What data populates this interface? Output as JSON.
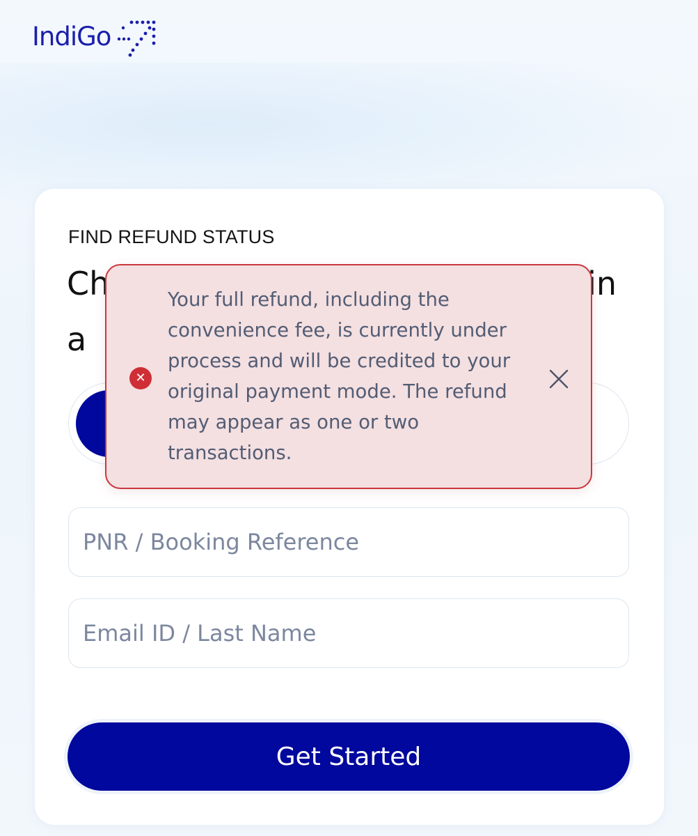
{
  "header": {
    "logo_text": "IndiGo",
    "logo_icon": "indigo-plane-dots-logo",
    "brand_color": "#1b1eaa"
  },
  "card": {
    "eyebrow": "FIND REFUND STATUS",
    "heading_visible_start_line1": "Ch",
    "heading_visible_end_line1": "in",
    "heading_visible_start_line2": "a"
  },
  "form": {
    "pnr_placeholder": "PNR / Booking Reference",
    "email_placeholder": "Email ID / Last Name",
    "submit_label": "Get Started",
    "button_color": "#00089d"
  },
  "toast": {
    "message": "Your full refund, including the convenience fee, is currently under process and will be credited to your original payment mode. The refund may appear as one or two transactions.",
    "status_icon": "error-x-icon",
    "close_icon": "close-icon",
    "background": "#f4dfe1",
    "border_color": "#c9383d",
    "icon_color": "#cf2e36"
  }
}
